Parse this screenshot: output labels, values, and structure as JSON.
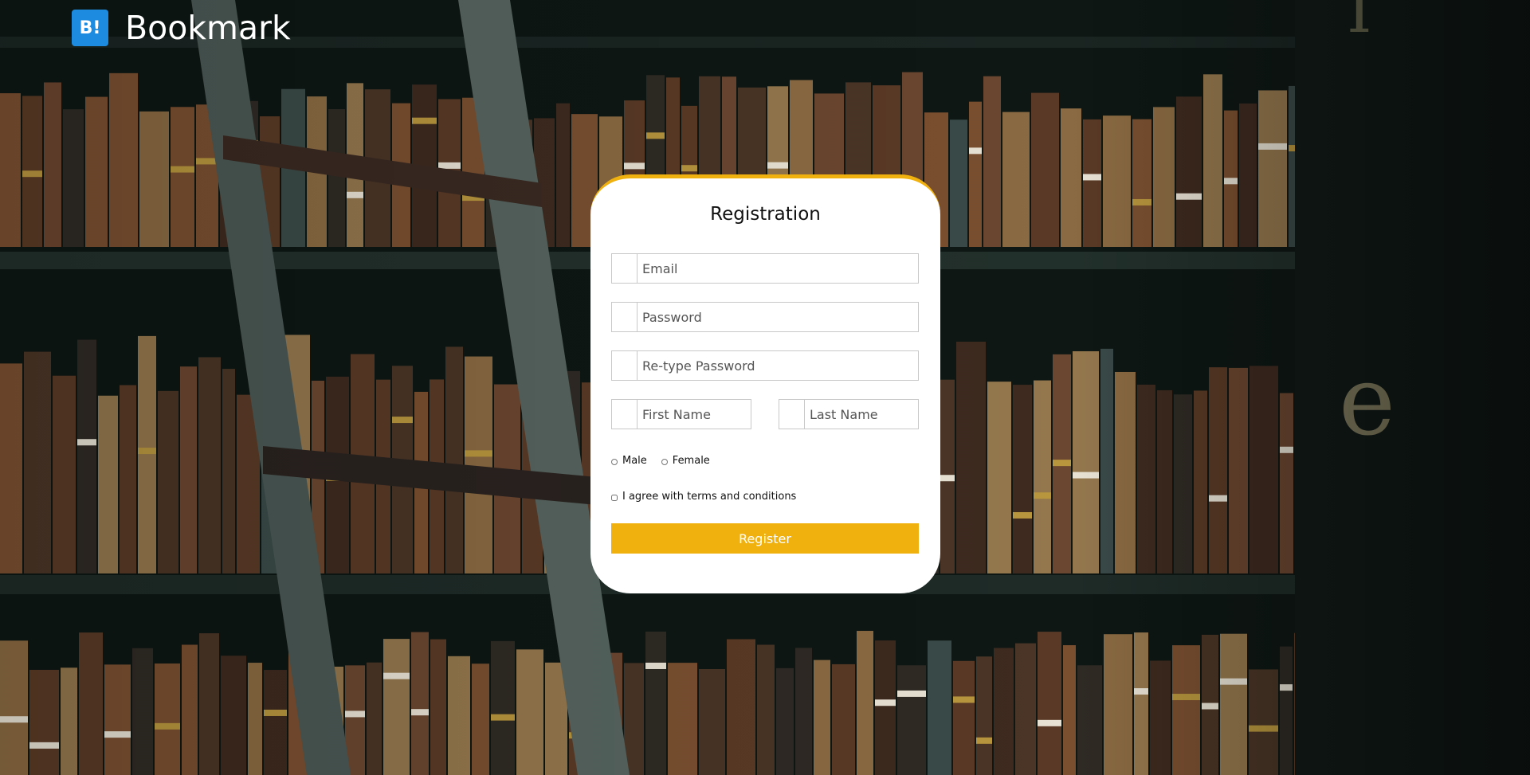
{
  "brand": {
    "icon_text": "B!",
    "name": "Bookmark",
    "icon_color": "#1d8ce0"
  },
  "form": {
    "title": "Registration",
    "accent_color": "#f0b10f",
    "email_placeholder": "Email",
    "password_placeholder": "Password",
    "retype_password_placeholder": "Re-type Password",
    "first_name_placeholder": "First Name",
    "last_name_placeholder": "Last Name",
    "gender_options": [
      "Male",
      "Female"
    ],
    "terms_label": "I agree with terms and conditions",
    "register_label": "Register"
  }
}
